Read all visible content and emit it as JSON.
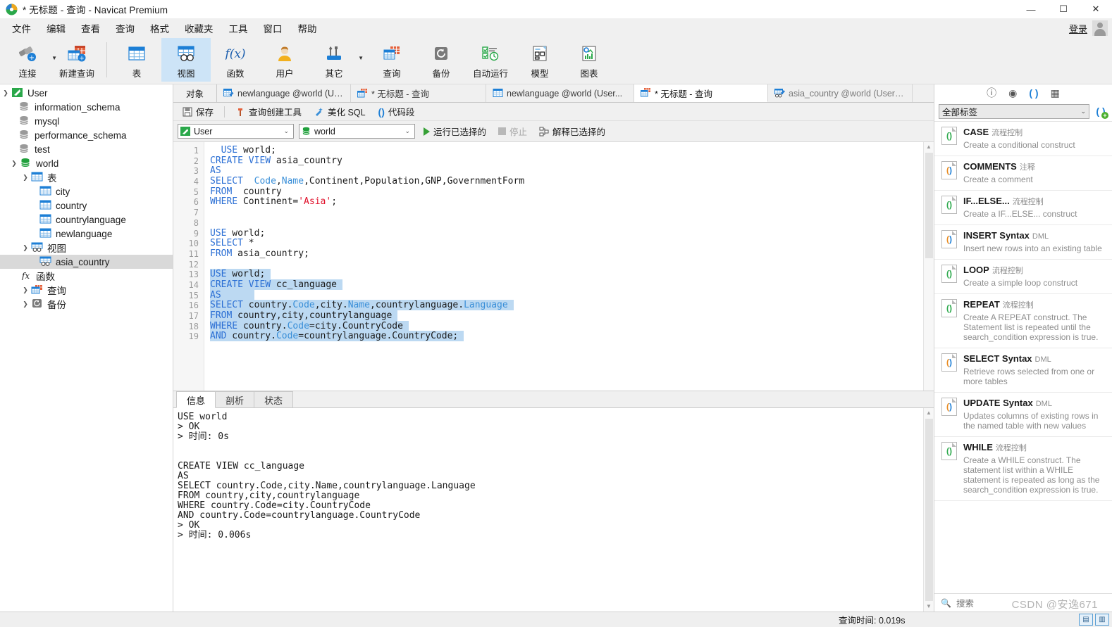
{
  "window": {
    "title": "* 无标题 - 查询 - Navicat Premium",
    "minimize": "—",
    "maximize": "☐",
    "close": "✕"
  },
  "menu": {
    "items": [
      {
        "label": "文件"
      },
      {
        "label": "编辑"
      },
      {
        "label": "查看"
      },
      {
        "label": "查询"
      },
      {
        "label": "格式"
      },
      {
        "label": "收藏夹"
      },
      {
        "label": "工具"
      },
      {
        "label": "窗口"
      },
      {
        "label": "帮助"
      }
    ],
    "login_label": "登录"
  },
  "toolbar": {
    "items": [
      {
        "label": "连接",
        "icon": "connection-icon",
        "has_caret": true,
        "active": false
      },
      {
        "label": "新建查询",
        "icon": "new-query-icon",
        "has_caret": false,
        "active": false
      },
      {
        "label": "表",
        "icon": "table-icon",
        "has_caret": false,
        "active": false
      },
      {
        "label": "视图",
        "icon": "view-icon",
        "has_caret": false,
        "active": true
      },
      {
        "label": "函数",
        "icon": "function-icon",
        "has_caret": false,
        "active": false
      },
      {
        "label": "用户",
        "icon": "user-icon",
        "has_caret": false,
        "active": false
      },
      {
        "label": "其它",
        "icon": "other-tools-icon",
        "has_caret": true,
        "active": false
      },
      {
        "label": "查询",
        "icon": "query-icon",
        "has_caret": false,
        "active": false
      },
      {
        "label": "备份",
        "icon": "backup-icon",
        "has_caret": false,
        "active": false
      },
      {
        "label": "自动运行",
        "icon": "automation-icon",
        "has_caret": false,
        "active": false
      },
      {
        "label": "模型",
        "icon": "model-icon",
        "has_caret": false,
        "active": false
      },
      {
        "label": "图表",
        "icon": "chart-icon",
        "has_caret": false,
        "active": false
      }
    ]
  },
  "sidebar": {
    "nodes": [
      {
        "label": "User",
        "depth": 0,
        "twist": "v",
        "icon": "navicat-connection-icon",
        "selected": false
      },
      {
        "label": "information_schema",
        "depth": 1,
        "twist": "",
        "icon": "database-icon",
        "selected": false
      },
      {
        "label": "mysql",
        "depth": 1,
        "twist": "",
        "icon": "database-icon",
        "selected": false
      },
      {
        "label": "performance_schema",
        "depth": 1,
        "twist": "",
        "icon": "database-icon",
        "selected": false
      },
      {
        "label": "test",
        "depth": 1,
        "twist": "",
        "icon": "database-icon",
        "selected": false
      },
      {
        "label": "world",
        "depth": 1,
        "twist": "v",
        "icon": "database-open-icon",
        "selected": false
      },
      {
        "label": "表",
        "depth": 2,
        "twist": "v",
        "icon": "tables-folder-icon",
        "selected": false
      },
      {
        "label": "city",
        "depth": 3,
        "twist": "",
        "icon": "table-icon",
        "selected": false
      },
      {
        "label": "country",
        "depth": 3,
        "twist": "",
        "icon": "table-icon",
        "selected": false
      },
      {
        "label": "countrylanguage",
        "depth": 3,
        "twist": "",
        "icon": "table-icon",
        "selected": false
      },
      {
        "label": "newlanguage",
        "depth": 3,
        "twist": "",
        "icon": "table-icon",
        "selected": false
      },
      {
        "label": "视图",
        "depth": 2,
        "twist": "v",
        "icon": "views-folder-icon",
        "selected": false
      },
      {
        "label": "asia_country",
        "depth": 3,
        "twist": "",
        "icon": "view-icon",
        "selected": true
      },
      {
        "label": "函数",
        "depth": 2,
        "twist": "",
        "icon": "functions-folder-icon",
        "selected": false
      },
      {
        "label": "查询",
        "depth": 2,
        "twist": ">",
        "icon": "queries-folder-icon",
        "selected": false
      },
      {
        "label": "备份",
        "depth": 2,
        "twist": ">",
        "icon": "backups-folder-icon",
        "selected": false
      }
    ]
  },
  "tabs": {
    "object_tab": "对象",
    "items": [
      {
        "label": "newlanguage @world (User...",
        "icon": "table-design-icon",
        "active": false
      },
      {
        "label": "* 无标题 - 查询",
        "icon": "query-icon",
        "active": false
      },
      {
        "label": "newlanguage @world (User...",
        "icon": "table-icon",
        "active": false
      },
      {
        "label": "* 无标题 - 查询",
        "icon": "query-icon",
        "active": true
      },
      {
        "label": "asia_country @world (User) ...",
        "icon": "view-design-icon",
        "active": false
      }
    ]
  },
  "editor_toolbar": {
    "save": "保存",
    "query_builder": "查询创建工具",
    "beautify_sql": "美化 SQL",
    "code_snippet": "代码段"
  },
  "editor_toolbar2": {
    "connection_value": "User",
    "database_value": "world",
    "run_selected": "运行已选择的",
    "stop": "停止",
    "explain_selected": "解释已选择的"
  },
  "sql_editor": {
    "line_count": 19,
    "lines": [
      {
        "n": 1,
        "selected": false,
        "tokens": [
          {
            "t": "  ",
            "c": "pl"
          },
          {
            "t": "USE",
            "c": "kw"
          },
          {
            "t": " world;",
            "c": "pl"
          }
        ]
      },
      {
        "n": 2,
        "selected": false,
        "tokens": [
          {
            "t": "CREATE VIEW",
            "c": "kw"
          },
          {
            "t": " asia_country",
            "c": "pl"
          }
        ]
      },
      {
        "n": 3,
        "selected": false,
        "tokens": [
          {
            "t": "AS",
            "c": "kw"
          }
        ]
      },
      {
        "n": 4,
        "selected": false,
        "tokens": [
          {
            "t": "SELECT",
            "c": "kw"
          },
          {
            "t": "  ",
            "c": "pl"
          },
          {
            "t": "Code",
            "c": "fn"
          },
          {
            "t": ",",
            "c": "pl"
          },
          {
            "t": "Name",
            "c": "fn"
          },
          {
            "t": ",Continent,Population,GNP,GovernmentForm",
            "c": "pl"
          }
        ]
      },
      {
        "n": 5,
        "selected": false,
        "tokens": [
          {
            "t": "FROM",
            "c": "kw"
          },
          {
            "t": "  country",
            "c": "pl"
          }
        ]
      },
      {
        "n": 6,
        "selected": false,
        "tokens": [
          {
            "t": "WHERE",
            "c": "kw"
          },
          {
            "t": " Continent=",
            "c": "pl"
          },
          {
            "t": "'Asia'",
            "c": "str"
          },
          {
            "t": ";",
            "c": "pl"
          }
        ]
      },
      {
        "n": 7,
        "selected": false,
        "tokens": []
      },
      {
        "n": 8,
        "selected": false,
        "tokens": []
      },
      {
        "n": 9,
        "selected": false,
        "tokens": [
          {
            "t": "USE",
            "c": "kw"
          },
          {
            "t": " world;",
            "c": "pl"
          }
        ]
      },
      {
        "n": 10,
        "selected": false,
        "tokens": [
          {
            "t": "SELECT",
            "c": "kw"
          },
          {
            "t": " *",
            "c": "pl"
          }
        ]
      },
      {
        "n": 11,
        "selected": false,
        "tokens": [
          {
            "t": "FROM",
            "c": "kw"
          },
          {
            "t": " asia_country;",
            "c": "pl"
          }
        ]
      },
      {
        "n": 12,
        "selected": false,
        "tokens": []
      },
      {
        "n": 13,
        "selected": true,
        "tokens": [
          {
            "t": "USE",
            "c": "kw"
          },
          {
            "t": " world; ",
            "c": "pl"
          }
        ]
      },
      {
        "n": 14,
        "selected": true,
        "tokens": [
          {
            "t": "CREATE VIEW",
            "c": "kw"
          },
          {
            "t": " cc_language ",
            "c": "pl"
          }
        ]
      },
      {
        "n": 15,
        "selected": true,
        "tokens": [
          {
            "t": "AS",
            "c": "kw"
          },
          {
            "t": "      ",
            "c": "pl"
          }
        ]
      },
      {
        "n": 16,
        "selected": true,
        "tokens": [
          {
            "t": "SELECT",
            "c": "kw"
          },
          {
            "t": " country.",
            "c": "pl"
          },
          {
            "t": "Code",
            "c": "fn"
          },
          {
            "t": ",city.",
            "c": "pl"
          },
          {
            "t": "Name",
            "c": "fn"
          },
          {
            "t": ",countrylanguage.",
            "c": "pl"
          },
          {
            "t": "Language",
            "c": "fn"
          },
          {
            "t": " ",
            "c": "pl"
          }
        ]
      },
      {
        "n": 17,
        "selected": true,
        "tokens": [
          {
            "t": "FROM",
            "c": "kw"
          },
          {
            "t": " country,city,countrylanguage ",
            "c": "pl"
          }
        ]
      },
      {
        "n": 18,
        "selected": true,
        "tokens": [
          {
            "t": "WHERE",
            "c": "kw"
          },
          {
            "t": " country.",
            "c": "pl"
          },
          {
            "t": "Code",
            "c": "fn"
          },
          {
            "t": "=city.CountryCode ",
            "c": "pl"
          }
        ]
      },
      {
        "n": 19,
        "selected": true,
        "tokens": [
          {
            "t": "AND",
            "c": "kw"
          },
          {
            "t": " country.",
            "c": "pl"
          },
          {
            "t": "Code",
            "c": "fn"
          },
          {
            "t": "=countrylanguage.CountryCode; ",
            "c": "pl"
          }
        ]
      }
    ]
  },
  "results": {
    "tabs": [
      {
        "label": "信息",
        "active": true
      },
      {
        "label": "剖析",
        "active": false
      },
      {
        "label": "状态",
        "active": false
      }
    ],
    "output": "USE world\n> OK\n> 时间: 0s\n\n\nCREATE VIEW cc_language\nAS\nSELECT country.Code,city.Name,countrylanguage.Language\nFROM country,city,countrylanguage\nWHERE country.Code=city.CountryCode\nAND country.Code=countrylanguage.CountryCode\n> OK\n> 时间: 0.006s"
  },
  "right_panel": {
    "icons": [
      {
        "name": "info-icon",
        "glyph": "ⓘ",
        "active": false
      },
      {
        "name": "preview-eye-icon",
        "glyph": "◉",
        "active": false
      },
      {
        "name": "snippet-parens-icon",
        "glyph": "( )",
        "active": true
      },
      {
        "name": "grid-icon",
        "glyph": "▦",
        "active": false
      }
    ],
    "filter_value": "全部标签",
    "add_snippet_label": "( )",
    "search_placeholder": "搜索",
    "snippets": [
      {
        "title": "CASE",
        "category": "流程控制",
        "desc": "Create a conditional construct",
        "accent": "green"
      },
      {
        "title": "COMMENTS",
        "category": "注释",
        "desc": "Create a comment",
        "accent": "orange"
      },
      {
        "title": "IF...ELSE...",
        "category": "流程控制",
        "desc": "Create a IF...ELSE... construct",
        "accent": "green"
      },
      {
        "title": "INSERT Syntax",
        "category": "DML",
        "desc": "Insert new rows into an existing table",
        "accent": "orange"
      },
      {
        "title": "LOOP",
        "category": "流程控制",
        "desc": "Create a simple loop construct",
        "accent": "green"
      },
      {
        "title": "REPEAT",
        "category": "流程控制",
        "desc": "Create A REPEAT construct. The Statement list is repeated until the search_condition expression is true.",
        "accent": "green"
      },
      {
        "title": "SELECT Syntax",
        "category": "DML",
        "desc": "Retrieve rows selected from one or more tables",
        "accent": "orange"
      },
      {
        "title": "UPDATE Syntax",
        "category": "DML",
        "desc": "Updates columns of existing rows in the named table with new values",
        "accent": "orange"
      },
      {
        "title": "WHILE",
        "category": "流程控制",
        "desc": "Create a WHILE construct. The statement list within a WHILE statement is repeated as long as the search_condition expression is true.",
        "accent": "green"
      }
    ]
  },
  "statusbar": {
    "query_time": "查询时间: 0.019s",
    "watermark": "CSDN @安逸671"
  },
  "colors": {
    "accent_blue": "#1d7fd6",
    "selection": "#bcd9f2",
    "keyword": "#2b6fd4",
    "string": "#e0112b",
    "toolbar_bg": "#f0f0f0",
    "active_tab": "#cde4f7"
  }
}
